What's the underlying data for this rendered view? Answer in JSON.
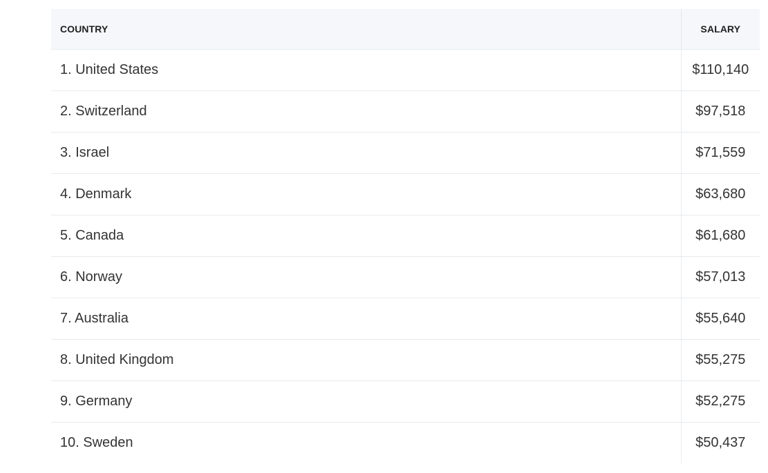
{
  "table": {
    "headers": {
      "country": "COUNTRY",
      "salary": "SALARY"
    },
    "rows": [
      {
        "country": "1. United States",
        "salary": "$110,140"
      },
      {
        "country": "2. Switzerland",
        "salary": "$97,518"
      },
      {
        "country": "3. Israel",
        "salary": "$71,559"
      },
      {
        "country": "4. Denmark",
        "salary": "$63,680"
      },
      {
        "country": "5. Canada",
        "salary": "$61,680"
      },
      {
        "country": "6. Norway",
        "salary": "$57,013"
      },
      {
        "country": "7. Australia",
        "salary": "$55,640"
      },
      {
        "country": "8. United Kingdom",
        "salary": "$55,275"
      },
      {
        "country": "9. Germany",
        "salary": "$52,275"
      },
      {
        "country": "10. Sweden",
        "salary": "$50,437"
      }
    ]
  },
  "colors": {
    "header_background": "#f5f7fa",
    "row_border": "#e6eaee",
    "text": "#333333"
  }
}
